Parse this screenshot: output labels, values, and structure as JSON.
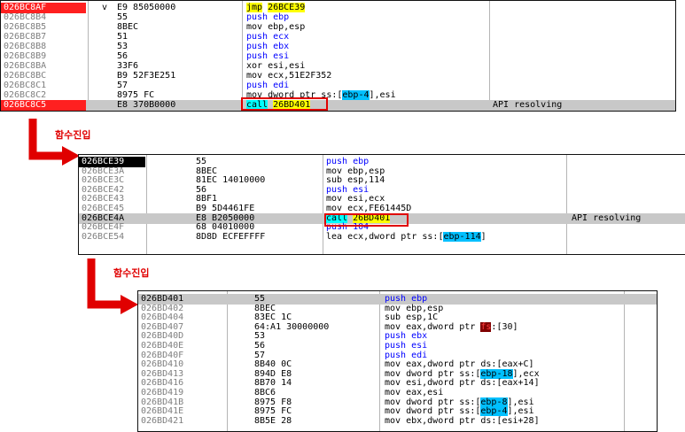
{
  "panel1": {
    "rows": [
      {
        "addr": "026BC8AF",
        "bytes": "E9 85050000",
        "prefix": "v",
        "segs": [
          {
            "t": "jmp",
            "c": "kw-jmp"
          },
          {
            "t": " "
          },
          {
            "t": "26BCE39",
            "c": "tgt"
          }
        ],
        "comment": "",
        "addr_style": "selred",
        "hl": false
      },
      {
        "addr": "026BC8B4",
        "bytes": "55",
        "segs": [
          {
            "t": "push ebp",
            "c": "kw-push"
          }
        ],
        "comment": "",
        "hl": false
      },
      {
        "addr": "026BC8B5",
        "bytes": "8BEC",
        "segs": [
          {
            "t": "mov ebp,esp"
          }
        ],
        "comment": "",
        "hl": false
      },
      {
        "addr": "026BC8B7",
        "bytes": "51",
        "segs": [
          {
            "t": "push ecx",
            "c": "kw-push"
          }
        ],
        "comment": "",
        "hl": false
      },
      {
        "addr": "026BC8B8",
        "bytes": "53",
        "segs": [
          {
            "t": "push ebx",
            "c": "kw-push"
          }
        ],
        "comment": "",
        "hl": false
      },
      {
        "addr": "026BC8B9",
        "bytes": "56",
        "segs": [
          {
            "t": "push esi",
            "c": "kw-push"
          }
        ],
        "comment": "",
        "hl": false
      },
      {
        "addr": "026BC8BA",
        "bytes": "33F6",
        "segs": [
          {
            "t": "xor esi,esi"
          }
        ],
        "comment": "",
        "hl": false
      },
      {
        "addr": "026BC8BC",
        "bytes": "B9 52F3E251",
        "segs": [
          {
            "t": "mov ecx,51E2F352"
          }
        ],
        "comment": "",
        "hl": false
      },
      {
        "addr": "026BC8C1",
        "bytes": "57",
        "segs": [
          {
            "t": "push edi",
            "c": "kw-push"
          }
        ],
        "comment": "",
        "hl": false
      },
      {
        "addr": "026BC8C2",
        "bytes": "8975 FC",
        "segs": [
          {
            "t": "mov dword ptr "
          },
          {
            "t": "ss:",
            "c": "seg"
          },
          {
            "t": "["
          },
          {
            "t": "ebp-4",
            "c": "brk"
          },
          {
            "t": "],esi"
          }
        ],
        "comment": "",
        "hl": false
      },
      {
        "addr": "026BC8C5",
        "bytes": "E8 370B0000",
        "segs": [
          {
            "t": "call",
            "c": "kw-call"
          },
          {
            "t": " "
          },
          {
            "t": "26BD401",
            "c": "tgt"
          }
        ],
        "comment": "API resolving",
        "addr_style": "selred",
        "hl": true
      }
    ]
  },
  "panel2": {
    "rows": [
      {
        "addr": "026BCE39",
        "bytes": "55",
        "segs": [
          {
            "t": "push ebp",
            "c": "kw-push"
          }
        ],
        "comment": "",
        "addr_style": "selblk",
        "hl": false
      },
      {
        "addr": "026BCE3A",
        "bytes": "8BEC",
        "segs": [
          {
            "t": "mov ebp,esp"
          }
        ],
        "comment": "",
        "hl": false
      },
      {
        "addr": "026BCE3C",
        "bytes": "81EC 14010000",
        "segs": [
          {
            "t": "sub esp,114"
          }
        ],
        "comment": "",
        "hl": false
      },
      {
        "addr": "026BCE42",
        "bytes": "56",
        "segs": [
          {
            "t": "push esi",
            "c": "kw-push"
          }
        ],
        "comment": "",
        "hl": false
      },
      {
        "addr": "026BCE43",
        "bytes": "8BF1",
        "segs": [
          {
            "t": "mov esi,ecx"
          }
        ],
        "comment": "",
        "hl": false
      },
      {
        "addr": "026BCE45",
        "bytes": "B9 5D4461FE",
        "segs": [
          {
            "t": "mov ecx,FE61445D"
          }
        ],
        "comment": "",
        "hl": false
      },
      {
        "addr": "026BCE4A",
        "bytes": "E8 B2050000",
        "segs": [
          {
            "t": "call",
            "c": "kw-call"
          },
          {
            "t": " "
          },
          {
            "t": "26BD401",
            "c": "tgt"
          }
        ],
        "comment": "API resolving",
        "addr_style": "dark",
        "hl": true
      },
      {
        "addr": "026BCE4F",
        "bytes": "68 04010000",
        "segs": [
          {
            "t": "push 104",
            "c": "kw-push"
          }
        ],
        "comment": "",
        "hl": false
      },
      {
        "addr": "026BCE54",
        "bytes": "8D8D ECFEFFFF",
        "segs": [
          {
            "t": "lea ecx,dword ptr "
          },
          {
            "t": "ss:",
            "c": "seg"
          },
          {
            "t": "["
          },
          {
            "t": "ebp-114",
            "c": "brk"
          },
          {
            "t": "]"
          }
        ],
        "comment": "",
        "hl": false
      }
    ]
  },
  "panel3": {
    "rows": [
      {
        "addr": "026BD401",
        "bytes": "55",
        "segs": [
          {
            "t": "push ebp",
            "c": "kw-push"
          }
        ],
        "comment": "",
        "addr_style": "dark",
        "hl": true
      },
      {
        "addr": "026BD402",
        "bytes": "8BEC",
        "segs": [
          {
            "t": "mov ebp,esp"
          }
        ],
        "comment": "",
        "hl": false
      },
      {
        "addr": "026BD404",
        "bytes": "83EC 1C",
        "segs": [
          {
            "t": "sub esp,1C"
          }
        ],
        "comment": "",
        "hl": false
      },
      {
        "addr": "026BD407",
        "bytes": "64:A1 30000000",
        "segs": [
          {
            "t": "mov eax,dword ptr "
          },
          {
            "t": "fs",
            "c": "fs"
          },
          {
            "t": ":[30]"
          }
        ],
        "comment": "",
        "hl": false
      },
      {
        "addr": "026BD40D",
        "bytes": "53",
        "segs": [
          {
            "t": "push ebx",
            "c": "kw-push"
          }
        ],
        "comment": "",
        "hl": false
      },
      {
        "addr": "026BD40E",
        "bytes": "56",
        "segs": [
          {
            "t": "push esi",
            "c": "kw-push"
          }
        ],
        "comment": "",
        "hl": false
      },
      {
        "addr": "026BD40F",
        "bytes": "57",
        "segs": [
          {
            "t": "push edi",
            "c": "kw-push"
          }
        ],
        "comment": "",
        "hl": false
      },
      {
        "addr": "026BD410",
        "bytes": "8B40 0C",
        "segs": [
          {
            "t": "mov eax,dword ptr "
          },
          {
            "t": "ds:",
            "c": "seg"
          },
          {
            "t": "[eax+C]"
          }
        ],
        "comment": "",
        "hl": false
      },
      {
        "addr": "026BD413",
        "bytes": "894D E8",
        "segs": [
          {
            "t": "mov dword ptr "
          },
          {
            "t": "ss:",
            "c": "seg"
          },
          {
            "t": "["
          },
          {
            "t": "ebp-18",
            "c": "brk"
          },
          {
            "t": "],ecx"
          }
        ],
        "comment": "",
        "hl": false
      },
      {
        "addr": "026BD416",
        "bytes": "8B70 14",
        "segs": [
          {
            "t": "mov esi,dword ptr "
          },
          {
            "t": "ds:",
            "c": "seg"
          },
          {
            "t": "[eax+14]"
          }
        ],
        "comment": "",
        "hl": false
      },
      {
        "addr": "026BD419",
        "bytes": "8BC6",
        "segs": [
          {
            "t": "mov eax,esi"
          }
        ],
        "comment": "",
        "hl": false
      },
      {
        "addr": "026BD41B",
        "bytes": "8975 F8",
        "segs": [
          {
            "t": "mov dword ptr "
          },
          {
            "t": "ss:",
            "c": "seg"
          },
          {
            "t": "["
          },
          {
            "t": "ebp-8",
            "c": "brk"
          },
          {
            "t": "],esi"
          }
        ],
        "comment": "",
        "hl": false
      },
      {
        "addr": "026BD41E",
        "bytes": "8975 FC",
        "segs": [
          {
            "t": "mov dword ptr "
          },
          {
            "t": "ss:",
            "c": "seg"
          },
          {
            "t": "["
          },
          {
            "t": "ebp-4",
            "c": "brk"
          },
          {
            "t": "],esi"
          }
        ],
        "comment": "",
        "hl": false
      },
      {
        "addr": "026BD421",
        "bytes": "8B5E 28",
        "segs": [
          {
            "t": "mov ebx,dword ptr "
          },
          {
            "t": "ds:",
            "c": "seg"
          },
          {
            "t": "[esi+28]"
          }
        ],
        "comment": "",
        "hl": false
      }
    ]
  },
  "arrows": {
    "label1": "함수진입",
    "label2": "함수진입",
    "color": "#e00000"
  },
  "colors": {
    "selected_addr_red": "#ff2020",
    "selected_addr_black": "#000000",
    "highlight_row": "#c8c8c8",
    "call_box": "#e00000",
    "jmp_call_target": "#ffff00",
    "call_mnemonic": "#00ffff",
    "push_mnemonic": "#0000ff"
  }
}
